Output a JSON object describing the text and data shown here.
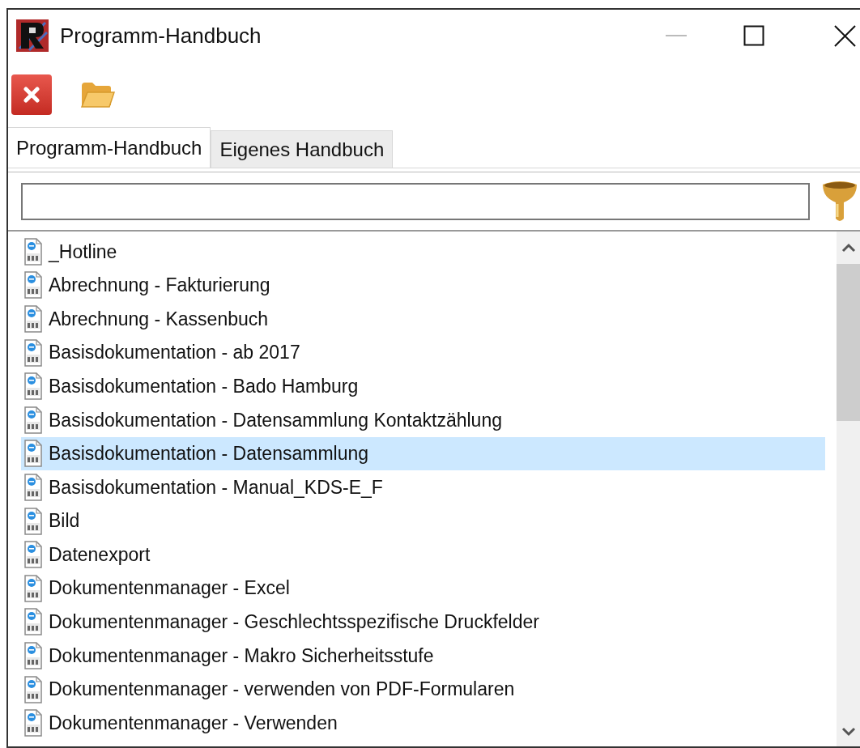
{
  "window": {
    "title": "Programm-Handbuch"
  },
  "tabs": [
    {
      "label": "Programm-Handbuch",
      "selected": true
    },
    {
      "label": "Eigenes Handbuch",
      "selected": false
    }
  ],
  "documents": [
    {
      "label": "_Hotline",
      "selected": false
    },
    {
      "label": "Abrechnung - Fakturierung",
      "selected": false
    },
    {
      "label": "Abrechnung - Kassenbuch",
      "selected": false
    },
    {
      "label": "Basisdokumentation - ab 2017",
      "selected": false
    },
    {
      "label": "Basisdokumentation - Bado Hamburg",
      "selected": false
    },
    {
      "label": "Basisdokumentation - Datensammlung Kontaktzählung",
      "selected": false
    },
    {
      "label": "Basisdokumentation - Datensammlung",
      "selected": true
    },
    {
      "label": "Basisdokumentation - Manual_KDS-E_F",
      "selected": false
    },
    {
      "label": "Bild",
      "selected": false
    },
    {
      "label": "Datenexport",
      "selected": false
    },
    {
      "label": "Dokumentenmanager - Excel",
      "selected": false
    },
    {
      "label": "Dokumentenmanager - Geschlechtsspezifische Druckfelder",
      "selected": false
    },
    {
      "label": "Dokumentenmanager - Makro Sicherheitsstufe",
      "selected": false
    },
    {
      "label": "Dokumentenmanager - verwenden von PDF-Formularen",
      "selected": false
    },
    {
      "label": "Dokumentenmanager - Verwenden",
      "selected": false
    }
  ]
}
